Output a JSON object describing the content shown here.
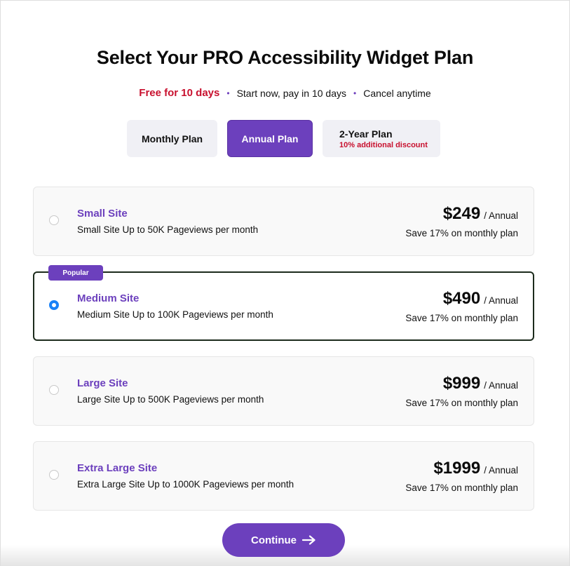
{
  "header": {
    "title": "Select Your PRO Accessibility Widget Plan",
    "highlights": {
      "free_trial": "Free for 10 days",
      "bullet_1": "Start now, pay in 10 days",
      "bullet_2": "Cancel anytime",
      "bullet_separator": "•"
    }
  },
  "billing_tabs": [
    {
      "label": "Monthly Plan",
      "active": false
    },
    {
      "label": "Annual Plan",
      "active": true
    },
    {
      "label": "2-Year Plan",
      "sublabel": "10% additional discount",
      "active": false
    }
  ],
  "plans": [
    {
      "name": "Small Site",
      "description": "Small Site Up to 50K Pageviews per month",
      "price": "$249",
      "period": "/ Annual",
      "savings": "Save 17% on monthly plan",
      "selected": false
    },
    {
      "name": "Medium Site",
      "description": "Medium Site Up to 100K Pageviews per month",
      "price": "$490",
      "period": "/ Annual",
      "savings": "Save 17% on monthly plan",
      "selected": true,
      "badge": "Popular"
    },
    {
      "name": "Large Site",
      "description": "Large Site Up to 500K Pageviews per month",
      "price": "$999",
      "period": "/ Annual",
      "savings": "Save 17% on monthly plan",
      "selected": false
    },
    {
      "name": "Extra Large Site",
      "description": "Extra Large Site Up to 1000K Pageviews per month",
      "price": "$1999",
      "period": "/ Annual",
      "savings": "Save 17% on monthly plan",
      "selected": false
    }
  ],
  "continue_button": {
    "label": "Continue",
    "icon": "arrow-right-icon"
  },
  "colors": {
    "accent": "#6c40bd",
    "highlight_red": "#c8102e",
    "radio_selected": "#1a82f7",
    "selected_border": "#1c2b1c"
  }
}
